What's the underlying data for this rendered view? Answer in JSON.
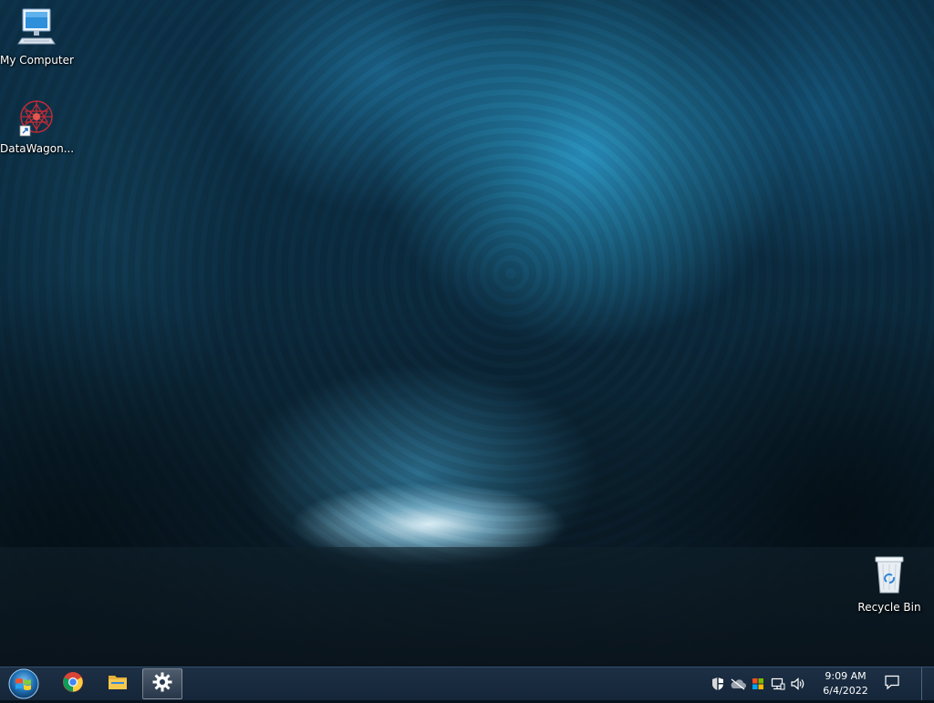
{
  "desktop": {
    "icons": [
      {
        "label": "My Computer",
        "icon": "computer-icon"
      },
      {
        "label": "DataWagon...",
        "icon": "datawagon-shortcut-icon"
      },
      {
        "label": "Recycle Bin",
        "icon": "recycle-bin-icon"
      }
    ]
  },
  "taskbar": {
    "start": {
      "icon": "windows-start-orb-icon"
    },
    "pinned": [
      {
        "name": "Google Chrome",
        "icon": "chrome-icon"
      },
      {
        "name": "File Explorer",
        "icon": "folder-icon"
      },
      {
        "name": "Settings",
        "icon": "gear-icon",
        "active": true
      }
    ],
    "tray": {
      "icons": [
        "security-shield-icon",
        "onedrive-cloud-icon",
        "windows-flag-icon",
        "network-icon",
        "volume-icon"
      ],
      "time": "9:09 AM",
      "date": "6/4/2022",
      "notification_icon": "action-center-icon"
    }
  },
  "colors": {
    "taskbar": "#1a2c41",
    "accent": "#2fa4e0"
  }
}
